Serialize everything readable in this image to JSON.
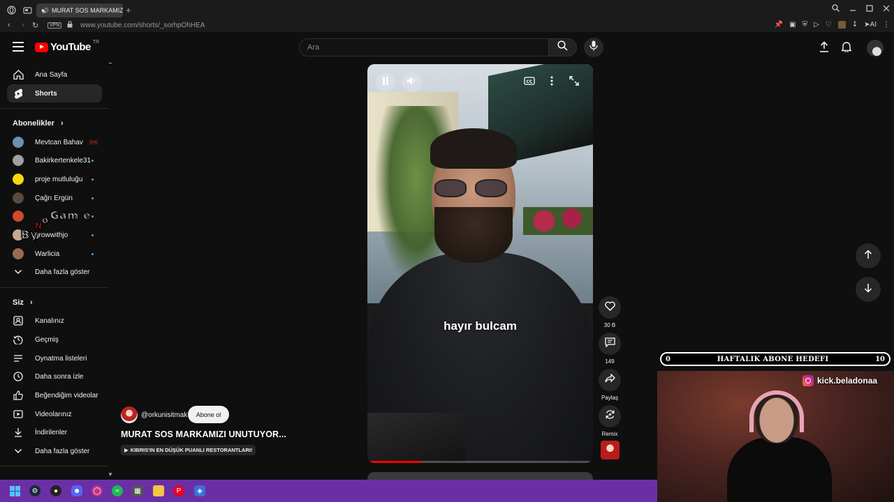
{
  "browser": {
    "tab_title": "MURAT SOS MARKAMIZ",
    "vpn_label": "VPN",
    "url": "www.youtube.com/shorts/_sorhpOhHEA",
    "ext_ai_label": "AI"
  },
  "header": {
    "logo_text": "YouTube",
    "country_code": "TR",
    "search_placeholder": "Ara"
  },
  "sidebar": {
    "main": [
      {
        "label": "Ana Sayfa",
        "icon": "home-icon"
      },
      {
        "label": "Shorts",
        "icon": "shorts-icon"
      }
    ],
    "subscriptions_heading": "Abonelikler",
    "subscriptions": [
      {
        "label": "Mevtcan Bahav",
        "live": true,
        "color": "#6b8fb5"
      },
      {
        "label": "Bakirkertenkele31",
        "color": "#a0a0a0"
      },
      {
        "label": "proje mutluluğu",
        "color": "#f5d90a"
      },
      {
        "label": "Çağrı Ergün",
        "color": "#5a4a3c"
      },
      {
        "label": "",
        "color": "#d04a2b"
      },
      {
        "label": "growwithjo",
        "color": "#c9a68f"
      },
      {
        "label": "Warlicia",
        "color": "#9a6a54"
      }
    ],
    "subs_show_more": "Daha fazla göster",
    "you_heading": "Siz",
    "you_items": [
      {
        "label": "Kanalınız",
        "icon": "channel-icon"
      },
      {
        "label": "Geçmiş",
        "icon": "history-icon"
      },
      {
        "label": "Oynatma listeleri",
        "icon": "playlist-icon"
      },
      {
        "label": "Daha sonra izle",
        "icon": "clock-icon"
      },
      {
        "label": "Beğendiğim videolar",
        "icon": "thumbs-up-icon"
      },
      {
        "label": "Videolarınız",
        "icon": "video-icon"
      },
      {
        "label": "İndirilenler",
        "icon": "download-icon"
      },
      {
        "label": "Daha fazla göster",
        "icon": "chevron-down-icon"
      }
    ]
  },
  "overlay_logo_text": "ByNoGame",
  "short": {
    "caption": "hayır bulcam",
    "progress": 0.23,
    "channel_handle": "@orkunisitmak",
    "subscribe_label": "Abone ol",
    "title": "MURAT SOS MARKAMIZI UNUTUYOR...",
    "chip_label": "KIBRIS'IN EN DÜŞÜK PUANLI RESTORANTLARI!"
  },
  "actions": {
    "likes": "30 B",
    "comments": "149",
    "share_label": "Paylaş",
    "remix_label": "Remix"
  },
  "stream": {
    "goal_title": "HAFTALIK ABONE HEDEFI",
    "goal_current": "0",
    "goal_target": "10",
    "social_handle": "kick.beladonaa"
  },
  "colors": {
    "accent": "#ff0000",
    "taskbar": "#6a2fa5",
    "link_dot": "#3ea6ff"
  }
}
